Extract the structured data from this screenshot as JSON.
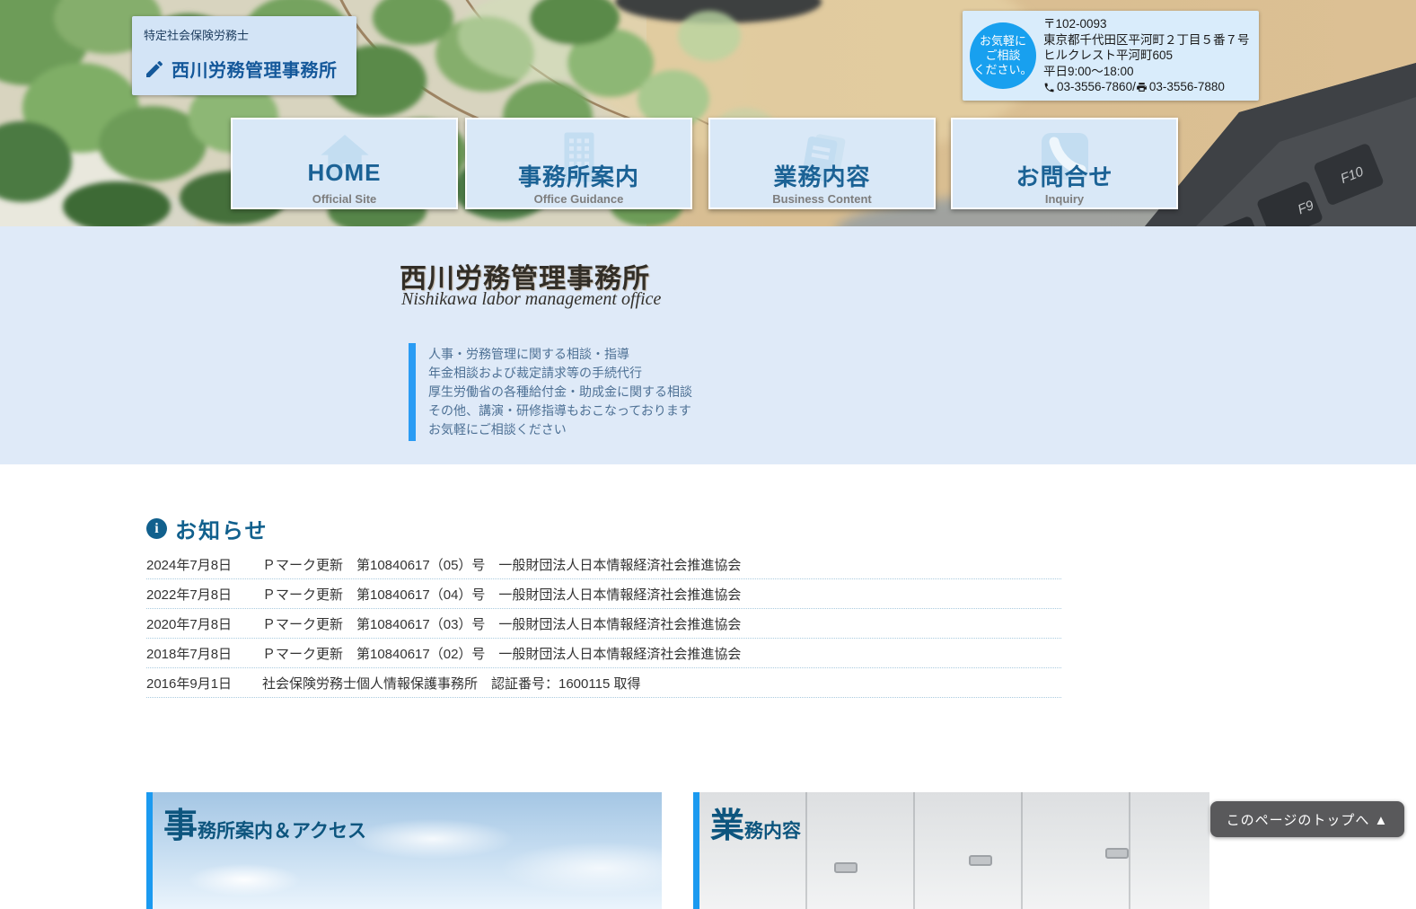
{
  "header": {
    "logo": {
      "qualification": "特定社会保険労務士",
      "office_name": "西川労務管理事務所"
    },
    "contact": {
      "badge": [
        "お気軽に",
        "ご相談",
        "ください。"
      ],
      "postal_code": "〒102-0093",
      "address_line1": "東京都千代田区平河町２丁目５番７号",
      "address_line2": "ヒルクレスト平河町605",
      "hours": "平日9:00～18:00",
      "phone": "03-3556-7860",
      "separator": "/",
      "fax": "03-3556-7880"
    },
    "nav": [
      {
        "label": "HOME",
        "sub": "Official Site"
      },
      {
        "label": "事務所案内",
        "sub": "Office Guidance"
      },
      {
        "label": "業務内容",
        "sub": "Business Content"
      },
      {
        "label": "お問合せ",
        "sub": "Inquiry"
      }
    ],
    "keyboard_keys": [
      "F9",
      "F10"
    ]
  },
  "hero": {
    "title": "西川労務管理事務所",
    "subtitle": "Nishikawa labor management office",
    "services": [
      "人事・労務管理に関する相談・指導",
      "年金相談および裁定請求等の手続代行",
      "厚生労働省の各種給付金・助成金に関する相談",
      "その他、講演・研修指導もおこなっております",
      "お気軽にご相談ください"
    ]
  },
  "news": {
    "heading": "お知らせ",
    "info_glyph": "i",
    "items": [
      {
        "date": "2024年7月8日",
        "text": "Ｐマーク更新　第10840617（05）号　一般財団法人日本情報経済社会推進協会"
      },
      {
        "date": "2022年7月8日",
        "text": "Ｐマーク更新　第10840617（04）号　一般財団法人日本情報経済社会推進協会"
      },
      {
        "date": "2020年7月8日",
        "text": "Ｐマーク更新　第10840617（03）号　一般財団法人日本情報経済社会推進協会"
      },
      {
        "date": "2018年7月8日",
        "text": "Ｐマーク更新　第10840617（02）号　一般財団法人日本情報経済社会推進協会"
      },
      {
        "date": "2016年9月1日",
        "text": "社会保険労務士個人情報保護事務所　認証番号：1600115 取得"
      }
    ]
  },
  "sections": [
    {
      "lead": "事",
      "rest": "務所案内＆アクセス"
    },
    {
      "lead": "業",
      "rest": "務内容"
    }
  ],
  "back_to_top": "このページのトップへ ▲",
  "colors": {
    "accent_blue": "#2a9cf4",
    "dark_blue": "#11608d",
    "badge_blue": "#18a0ef",
    "panel_blue": "#d9e8f7",
    "hero_bg": "#dfeaf8"
  }
}
